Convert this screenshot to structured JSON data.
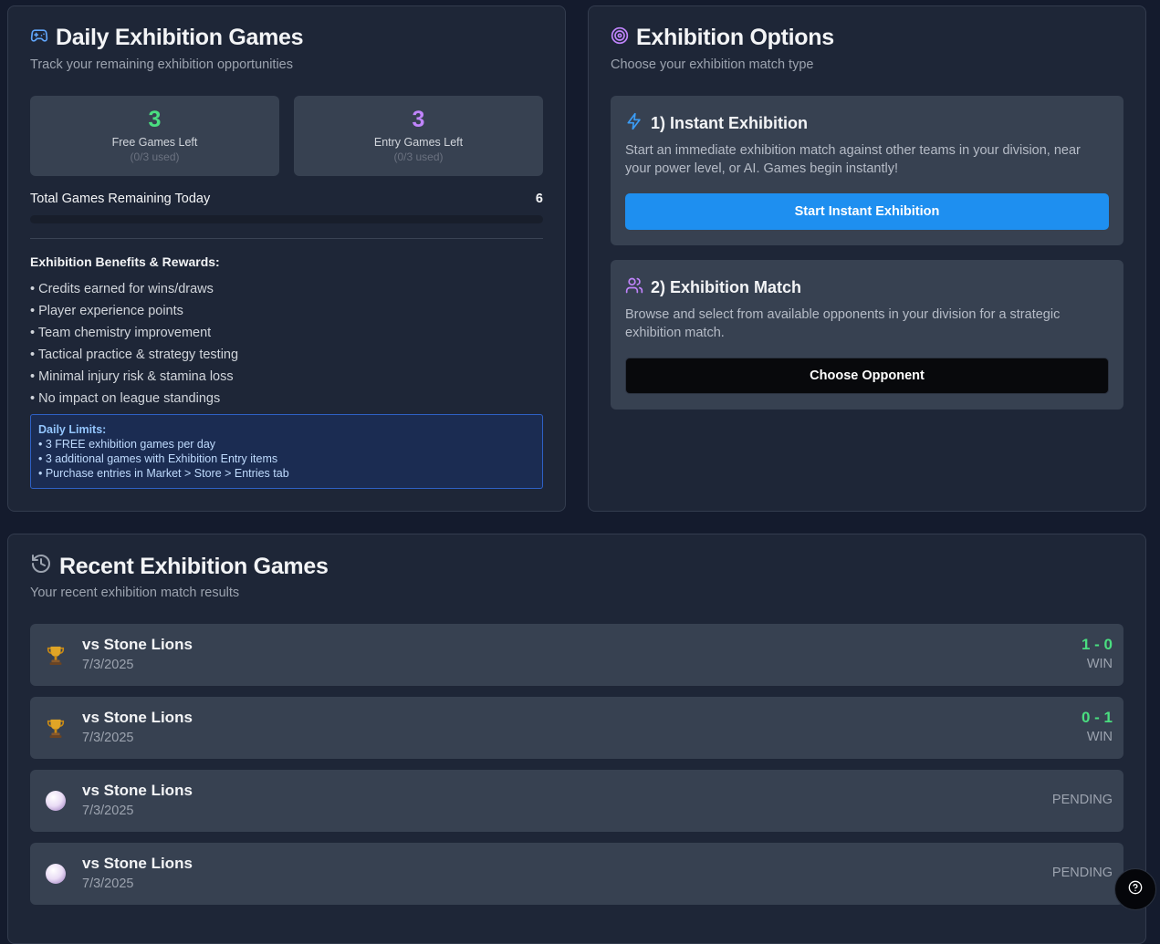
{
  "daily": {
    "title": "Daily Exhibition Games",
    "subtitle": "Track your remaining exhibition opportunities",
    "free": {
      "count": "3",
      "label": "Free Games Left",
      "used": "(0/3 used)",
      "color": "#4ade80"
    },
    "entry": {
      "count": "3",
      "label": "Entry Games Left",
      "used": "(0/3 used)",
      "color": "#c084fc"
    },
    "total_label": "Total Games Remaining Today",
    "total_value": "6",
    "progress_fraction": 0,
    "benefits_title": "Exhibition Benefits & Rewards:",
    "benefits": [
      "• Credits earned for wins/draws",
      "• Player experience points",
      "• Team chemistry improvement",
      "• Tactical practice & strategy testing",
      "• Minimal injury risk & stamina loss",
      "• No impact on league standings"
    ],
    "limits_title": "Daily Limits:",
    "limits": [
      "• 3 FREE exhibition games per day",
      "• 3 additional games with Exhibition Entry items",
      "• Purchase entries in Market > Store > Entries tab"
    ]
  },
  "options": {
    "title": "Exhibition Options",
    "subtitle": "Choose your exhibition match type",
    "instant": {
      "title": "1) Instant Exhibition",
      "desc": "Start an immediate exhibition match against other teams in your division, near your power level, or AI. Games begin instantly!",
      "button": "Start Instant Exhibition"
    },
    "match": {
      "title": "2) Exhibition Match",
      "desc": "Browse and select from available opponents in your division for a strategic exhibition match.",
      "button": "Choose Opponent"
    }
  },
  "recent": {
    "title": "Recent Exhibition Games",
    "subtitle": "Your recent exhibition match results",
    "games": [
      {
        "icon": "trophy-icon",
        "opponent": "vs Stone Lions",
        "date": "7/3/2025",
        "score": "1 - 0",
        "result": "WIN"
      },
      {
        "icon": "trophy-icon",
        "opponent": "vs Stone Lions",
        "date": "7/3/2025",
        "score": "0 - 1",
        "result": "WIN"
      },
      {
        "icon": "pending-orb-icon",
        "opponent": "vs Stone Lions",
        "date": "7/3/2025",
        "score": "",
        "result": "PENDING"
      },
      {
        "icon": "pending-orb-icon",
        "opponent": "vs Stone Lions",
        "date": "7/3/2025",
        "score": "",
        "result": "PENDING"
      }
    ]
  },
  "colors": {
    "accent_blue": "#1e8ff0",
    "win_green": "#4ade80",
    "entry_purple": "#c084fc"
  }
}
